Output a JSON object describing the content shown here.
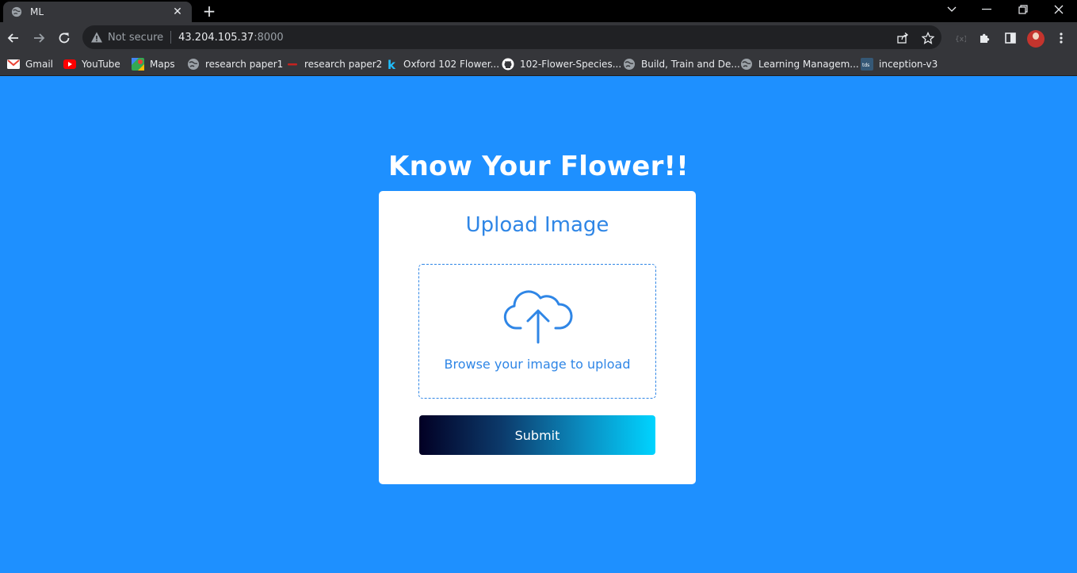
{
  "browser": {
    "tab_title": "ML",
    "new_tab_label": "+",
    "security_label": "Not secure",
    "url_host": "43.204.105.37",
    "url_port": ":8000"
  },
  "bookmarks": [
    {
      "label": "Gmail",
      "icon": "gmail-icon"
    },
    {
      "label": "YouTube",
      "icon": "youtube-icon"
    },
    {
      "label": "Maps",
      "icon": "maps-icon"
    },
    {
      "label": "research paper1",
      "icon": "globe-icon"
    },
    {
      "label": "research paper2",
      "icon": "redline-icon"
    },
    {
      "label": "Oxford 102 Flower...",
      "icon": "kaggle-icon"
    },
    {
      "label": "102-Flower-Species...",
      "icon": "github-icon"
    },
    {
      "label": "Build, Train and De...",
      "icon": "globe-icon"
    },
    {
      "label": "Learning Managem...",
      "icon": "globe-icon"
    },
    {
      "label": "inception-v3",
      "icon": "tds-icon"
    }
  ],
  "page": {
    "heading": "Know Your Flower!!",
    "card_title": "Upload Image",
    "drop_text": "Browse your image to upload",
    "submit_label": "Submit"
  },
  "colors": {
    "page_background": "#1e90ff",
    "accent": "#2f86e6",
    "button_gradient_start": "#020024",
    "button_gradient_end": "#00d4ff"
  }
}
